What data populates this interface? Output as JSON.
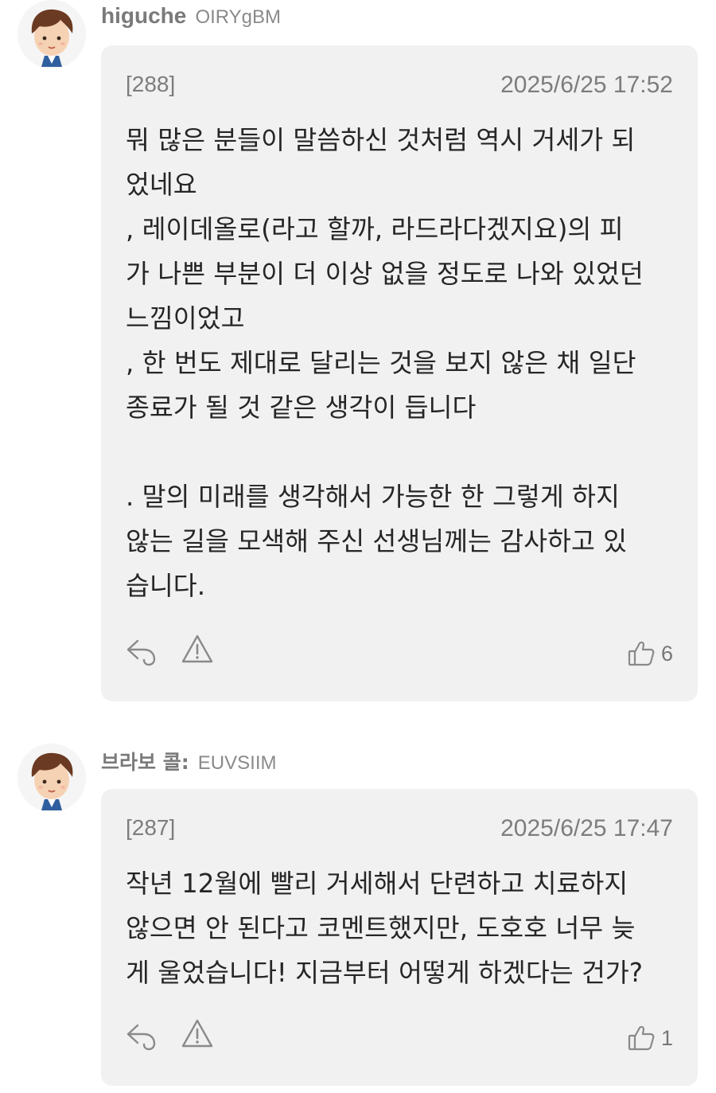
{
  "comments": [
    {
      "username": "higuche",
      "user_id": "OIRYgBM",
      "number": "[288]",
      "timestamp": "2025/6/25 17:52",
      "lines": [
        "뭐 많은 분들이 말씀하신 것처럼 역시 거세가 되",
        "었네요",
        ", 레이데올로(라고 할까, 라드라다겠지요)의 피",
        "가 나쁜 부분이 더 이상 없을 정도로 나와 있었던",
        "느낌이었고",
        ", 한 번도 제대로 달리는 것을 보지 않은 채 일단",
        "종료가 될 것 같은 생각이 듭니다",
        "",
        ". 말의 미래를 생각해서 가능한 한 그렇게 하지",
        "않는 길을 모색해 주신 선생님께는 감사하고 있",
        "습니다."
      ],
      "likes": "6",
      "icons": {
        "avatar": "avatar-icon",
        "reply": "reply-icon",
        "report": "warning-icon",
        "like": "thumbs-up-icon"
      }
    },
    {
      "username": "브라보 콜:",
      "user_id": "EUVSIIM",
      "number": "[287]",
      "timestamp": "2025/6/25 17:47",
      "lines": [
        "작년 12월에 빨리 거세해서 단련하고 치료하지",
        "않으면 안 된다고 코멘트했지만, 도호호 너무 늦",
        "게 울었습니다! 지금부터 어떻게 하겠다는 건가?"
      ],
      "likes": "1",
      "icons": {
        "avatar": "avatar-icon",
        "reply": "reply-icon",
        "report": "warning-icon",
        "like": "thumbs-up-icon"
      }
    }
  ],
  "colors": {
    "card_background": "#f1f1f1",
    "username": "#7a7a7a",
    "meta_text": "#7d7d7d",
    "body_text": "#262626",
    "icon_stroke": "#8a8a8a"
  }
}
